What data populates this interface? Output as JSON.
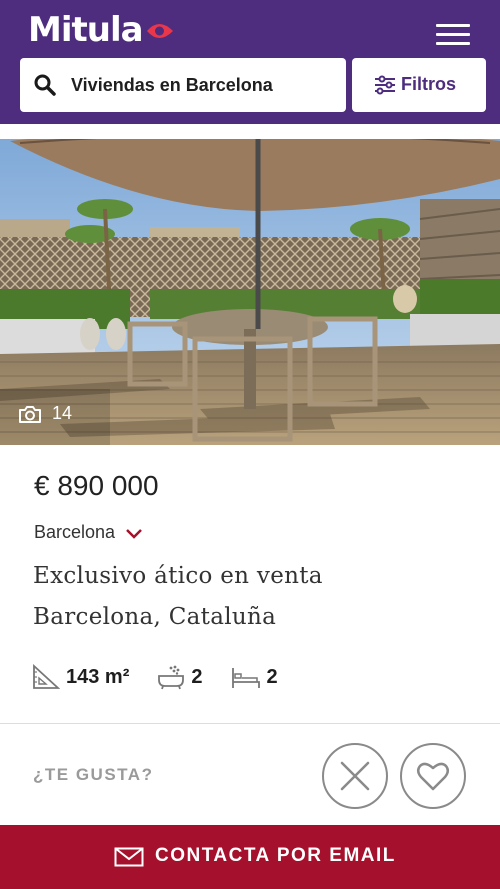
{
  "header": {
    "logo_text": "Mitula",
    "menu_icon": "hamburger-menu-icon",
    "brand_color": "#4e2d7f",
    "logo_accent_color": "#e8364a"
  },
  "search": {
    "query": "Viviendas en Barcelona",
    "icon": "search-icon",
    "filter_label": "Filtros",
    "filter_icon": "sliders-icon"
  },
  "listing": {
    "photo_count": "14",
    "price": "€ 890 000",
    "location": "Barcelona",
    "title_line1": "Exclusivo ático en venta",
    "title_line2": "Barcelona, Cataluña",
    "features": [
      {
        "icon": "area-icon",
        "value": "143 m²"
      },
      {
        "icon": "bathtub-icon",
        "value": "2"
      },
      {
        "icon": "bed-icon",
        "value": "2"
      }
    ]
  },
  "actions": {
    "like_prompt": "¿TE GUSTA?",
    "dislike_icon": "close-icon",
    "favorite_icon": "heart-icon"
  },
  "cta": {
    "label": "CONTACTA POR EMAIL",
    "icon": "envelope-icon",
    "color": "#a5112c"
  }
}
